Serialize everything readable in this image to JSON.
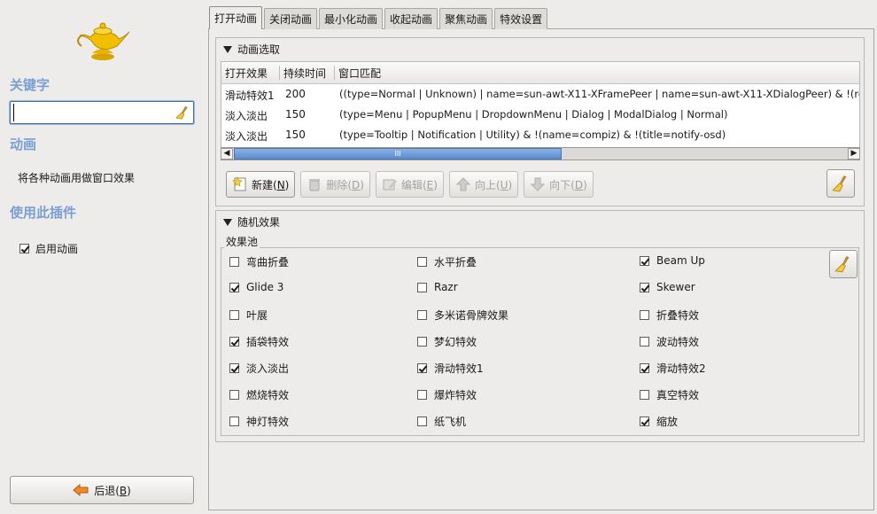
{
  "sidebar": {
    "keyword_heading": "关键字",
    "search_value": "",
    "animation_heading": "动画",
    "description": "将各种动画用做窗口效果",
    "use_plugin_heading": "使用此插件",
    "enable_label": "启用动画",
    "enable_checked": true,
    "back_label": "后退(",
    "back_key": "B",
    "back_suffix": ")"
  },
  "tabs": [
    {
      "label": "打开动画",
      "active": true
    },
    {
      "label": "关闭动画",
      "active": false
    },
    {
      "label": "最小化动画",
      "active": false
    },
    {
      "label": "收起动画",
      "active": false
    },
    {
      "label": "聚焦动画",
      "active": false
    },
    {
      "label": "特效设置",
      "active": false
    }
  ],
  "animation_select": {
    "title": "动画选取",
    "columns": [
      "打开效果",
      "持续时间",
      "窗口匹配"
    ],
    "rows": [
      {
        "effect": "滑动特效1",
        "duration": "200",
        "match": "((type=Normal | Unknown) | name=sun-awt-X11-XFramePeer | name=sun-awt-X11-XDialogPeer) & !(role="
      },
      {
        "effect": "淡入淡出",
        "duration": "150",
        "match": "(type=Menu | PopupMenu | DropdownMenu | Dialog | ModalDialog | Normal)"
      },
      {
        "effect": "淡入淡出",
        "duration": "150",
        "match": "(type=Tooltip | Notification | Utility) & !(name=compiz) & !(title=notify-osd)"
      }
    ],
    "scroll_grip": "III",
    "buttons": [
      {
        "name": "new",
        "label": "新建(",
        "key": "N",
        "suffix": ")",
        "disabled": false,
        "icon": "new-star-icon"
      },
      {
        "name": "delete",
        "label": "删除(",
        "key": "D",
        "suffix": ")",
        "disabled": true,
        "icon": "trash-icon"
      },
      {
        "name": "edit",
        "label": "编辑(",
        "key": "E",
        "suffix": ")",
        "disabled": true,
        "icon": "edit-icon"
      },
      {
        "name": "up",
        "label": "向上(",
        "key": "U",
        "suffix": ")",
        "disabled": true,
        "icon": "arrow-up-icon"
      },
      {
        "name": "down",
        "label": "向下(",
        "key": "D",
        "suffix": ")",
        "disabled": true,
        "icon": "arrow-down-icon"
      }
    ]
  },
  "random_effects": {
    "title": "随机效果",
    "pool_label": "效果池",
    "effects": [
      {
        "label": "弯曲折叠",
        "checked": false
      },
      {
        "label": "水平折叠",
        "checked": false
      },
      {
        "label": "Beam Up",
        "checked": true
      },
      {
        "label": "Glide 3",
        "checked": true
      },
      {
        "label": "Razr",
        "checked": false
      },
      {
        "label": "Skewer",
        "checked": true
      },
      {
        "label": "叶展",
        "checked": false
      },
      {
        "label": "多米诺骨牌效果",
        "checked": false
      },
      {
        "label": "折叠特效",
        "checked": false
      },
      {
        "label": "插袋特效",
        "checked": true
      },
      {
        "label": "梦幻特效",
        "checked": false
      },
      {
        "label": "波动特效",
        "checked": false
      },
      {
        "label": "淡入淡出",
        "checked": true
      },
      {
        "label": "滑动特效1",
        "checked": true
      },
      {
        "label": "滑动特效2",
        "checked": true
      },
      {
        "label": "燃烧特效",
        "checked": false
      },
      {
        "label": "爆炸特效",
        "checked": false
      },
      {
        "label": "真空特效",
        "checked": false
      },
      {
        "label": "神灯特效",
        "checked": false
      },
      {
        "label": "纸飞机",
        "checked": false
      },
      {
        "label": "缩放",
        "checked": true
      }
    ]
  },
  "colors": {
    "heading": "#7a9fd1",
    "accent": "#5a8ccf",
    "background": "#edeceb"
  }
}
